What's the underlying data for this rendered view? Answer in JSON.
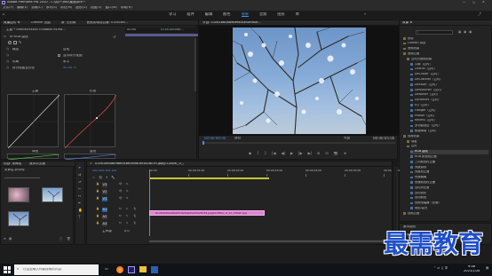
{
  "titlebar": {
    "title": "Adobe Premiere Pro 2020 - C:\\用户\\Ray\\桌面\\pre *",
    "controls": [
      "—",
      "□",
      "✕"
    ]
  },
  "menubar": {
    "items": [
      "文件(F)",
      "编辑(E)",
      "剪辑(C)",
      "序列(S)",
      "标记(M)",
      "图形(G)",
      "视图(V)",
      "窗口(W)",
      "帮助(H)"
    ]
  },
  "workspace_tabs": {
    "items": [
      "学习",
      "组件",
      "编辑",
      "颜色",
      "效果",
      "音频",
      "图形",
      "库"
    ],
    "active": "效果"
  },
  "effect_controls": {
    "tabs": [
      "效果控件 ≡",
      "Lumetri 范围",
      "源: 无剪辑",
      "音频剪辑混合器: 01c81b6..."
    ],
    "clip_header": "主要 * 0fe0fe09485c7c4ab6e7f49fa...",
    "seq_header": "01c81b60ab...",
    "timecode": "00:00",
    "fx_label": "fx RGB 曲线",
    "rows": [
      {
        "label": "输出",
        "value": "合成"
      },
      {
        "label": "",
        "value": "显示拆分视图"
      },
      {
        "label": "布局",
        "value": "水平"
      },
      {
        "label": "拆分视图百分比",
        "value": "50.00 %"
      }
    ],
    "curves_labels": [
      "主要",
      "红色",
      "绿色",
      "蓝色"
    ],
    "bottom_time": "00:00:00:00"
  },
  "program_monitor": {
    "title": "节目: 01c81b60ab9bef4c6e5a9d0e...",
    "timecode_left": "00:00:00:00",
    "fit": "适合",
    "quality": "完整",
    "timecode_right": "00:00:05:00",
    "transport": [
      "◆",
      "{",
      "}",
      "|◀",
      "◀|",
      "▶",
      "|▶",
      "▶|",
      "⊞",
      "⊟",
      "📷",
      "⊕"
    ]
  },
  "project_panel": {
    "tabs": [
      "项目: 未命名",
      "媒体浏览器"
    ],
    "filename": "未命名.prproj",
    "thumb_count": 3
  },
  "timeline": {
    "title": "01c81b60ab9bef4c6e5a9d0ef3a28c39.jpg@1280w_1l_2o_100sh",
    "timecode": "00:00:00:00",
    "ruler": [
      "00:00",
      "00:00:01:00",
      "00:00:02:00",
      "00:00:03:00",
      "00:00:04:00",
      "00:00:05:00",
      "00:00:06:00"
    ],
    "tracks": [
      "V3",
      "V2",
      "V1",
      "A1",
      "A2",
      "A3"
    ],
    "master": "主声道",
    "master_value": "0.0",
    "clip_label": "01c81b60ab9bef4c6e5a9d0ef3a28c39.jpg@1280w_1l_2o_100sh.jpg"
  },
  "effects_panel": {
    "title": "效果 ≡",
    "search_placeholder": "",
    "items": [
      {
        "indent": 0,
        "label": "预设",
        "kind": "folder"
      },
      {
        "indent": 0,
        "label": "Lumetri 预设",
        "kind": "folder"
      },
      {
        "indent": 0,
        "label": "音频效果",
        "kind": "folder"
      },
      {
        "indent": 0,
        "label": "音频过渡",
        "kind": "folder"
      },
      {
        "indent": 1,
        "label": "过时的音频效果",
        "kind": "folder"
      },
      {
        "indent": 2,
        "label": "平衡（过时）",
        "kind": "fx"
      },
      {
        "indent": 2,
        "label": "Chorus（过时）",
        "kind": "fx"
      },
      {
        "indent": 2,
        "label": "DeClicker（过时）",
        "kind": "fx"
      },
      {
        "indent": 2,
        "label": "DeCrackler（过时）",
        "kind": "fx"
      },
      {
        "indent": 2,
        "label": "DeEsser（过时）",
        "kind": "fx"
      },
      {
        "indent": 2,
        "label": "DeHummer（过时）",
        "kind": "fx"
      },
      {
        "indent": 2,
        "label": "DeNoiser（过时）",
        "kind": "fx"
      },
      {
        "indent": 2,
        "label": "Dynamics（过时）",
        "kind": "fx"
      },
      {
        "indent": 2,
        "label": "EQ（过时）",
        "kind": "fx"
      },
      {
        "indent": 2,
        "label": "Flanger（过时）",
        "kind": "fx"
      },
      {
        "indent": 2,
        "label": "Phaser（过时）",
        "kind": "fx"
      },
      {
        "indent": 2,
        "label": "Reverb（过时）",
        "kind": "fx"
      },
      {
        "indent": 2,
        "label": "多功能延迟（过时）",
        "kind": "fx"
      },
      {
        "indent": 2,
        "label": "频谱降噪（过时）",
        "kind": "fx"
      },
      {
        "indent": 0,
        "label": "视频效果",
        "kind": "folder"
      },
      {
        "indent": 1,
        "label": "调整",
        "kind": "folder"
      },
      {
        "indent": 1,
        "label": "过时",
        "kind": "folder"
      },
      {
        "indent": 2,
        "label": "RGB 曲线",
        "kind": "fx",
        "selected": true
      },
      {
        "indent": 2,
        "label": "RGB 颜色校正器",
        "kind": "fx"
      },
      {
        "indent": 2,
        "label": "三向颜色校正器",
        "kind": "fx"
      },
      {
        "indent": 2,
        "label": "亮度曲线",
        "kind": "fx"
      },
      {
        "indent": 2,
        "label": "亮度校正器",
        "kind": "fx"
      },
      {
        "indent": 2,
        "label": "快速模糊",
        "kind": "fx"
      },
      {
        "indent": 2,
        "label": "快速颜色校正器",
        "kind": "fx"
      },
      {
        "indent": 2,
        "label": "自动对比度",
        "kind": "fx"
      },
      {
        "indent": 2,
        "label": "自动色阶",
        "kind": "fx"
      },
      {
        "indent": 2,
        "label": "自动颜色",
        "kind": "fx"
      },
      {
        "indent": 2,
        "label": "视频限幅器（旧版）",
        "kind": "fx"
      },
      {
        "indent": 2,
        "label": "阴影/高光",
        "kind": "fx"
      },
      {
        "indent": 0,
        "label": "视频过渡",
        "kind": "folder"
      }
    ],
    "bottom_tabs": [
      "基本图形",
      "基本声音"
    ]
  },
  "watermark": "最需教育",
  "taskbar": {
    "search_placeholder": "在这里输入你要搜索的内容",
    "time": "9:48",
    "date": "2021/1/26"
  }
}
